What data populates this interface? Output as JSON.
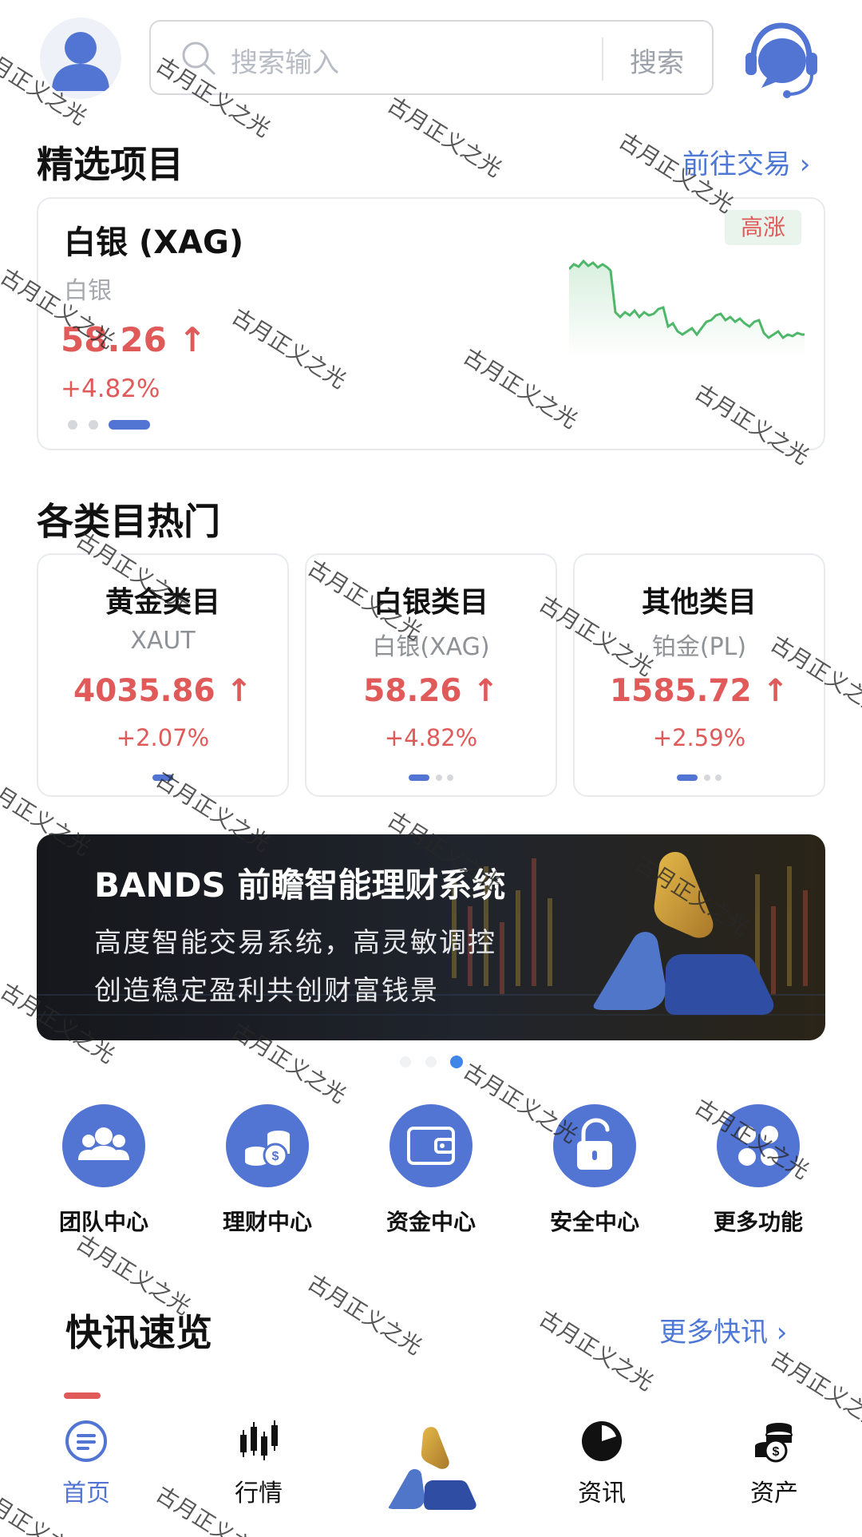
{
  "header": {
    "search_placeholder": "搜索输入",
    "search_button": "搜索"
  },
  "featured": {
    "title": "精选项目",
    "link": "前往交易 ›",
    "card": {
      "name": "白银 (XAG)",
      "sub": "白银",
      "price": "58.26 ↑",
      "change": "+4.82%",
      "badge": "高涨"
    }
  },
  "categories": {
    "title": "各类目热门",
    "items": [
      {
        "title": "黄金类目",
        "symbol": "XAUT",
        "price": "4035.86 ↑",
        "change": "+2.07%"
      },
      {
        "title": "白银类目",
        "symbol": "白银(XAG)",
        "price": "58.26 ↑",
        "change": "+4.82%"
      },
      {
        "title": "其他类目",
        "symbol": "铂金(PL)",
        "price": "1585.72 ↑",
        "change": "+2.59%"
      }
    ]
  },
  "banner": {
    "title": "BANDS 前瞻智能理财系统",
    "line1": "高度智能交易系统，高灵敏调控",
    "line2": "创造稳定盈利共创财富钱景"
  },
  "quick_actions": [
    {
      "label": "团队中心",
      "icon": "team-icon"
    },
    {
      "label": "理财中心",
      "icon": "coins-icon"
    },
    {
      "label": "资金中心",
      "icon": "wallet-icon"
    },
    {
      "label": "安全中心",
      "icon": "lock-icon"
    },
    {
      "label": "更多功能",
      "icon": "more-icon"
    }
  ],
  "news": {
    "title": "快讯速览",
    "link": "更多快讯 ›"
  },
  "tabbar": [
    {
      "label": "首页",
      "icon": "home-icon",
      "active": true
    },
    {
      "label": "行情",
      "icon": "candlestick-icon",
      "active": false
    },
    {
      "label": "",
      "icon": "brand-logo-icon",
      "active": false
    },
    {
      "label": "资讯",
      "icon": "pie-chart-icon",
      "active": false
    },
    {
      "label": "资产",
      "icon": "coin-stack-icon",
      "active": false
    }
  ],
  "watermark": "古月正义之光",
  "colors": {
    "accent": "#5274d3",
    "up": "#e05a5a",
    "sparkline": "#4fb769"
  }
}
